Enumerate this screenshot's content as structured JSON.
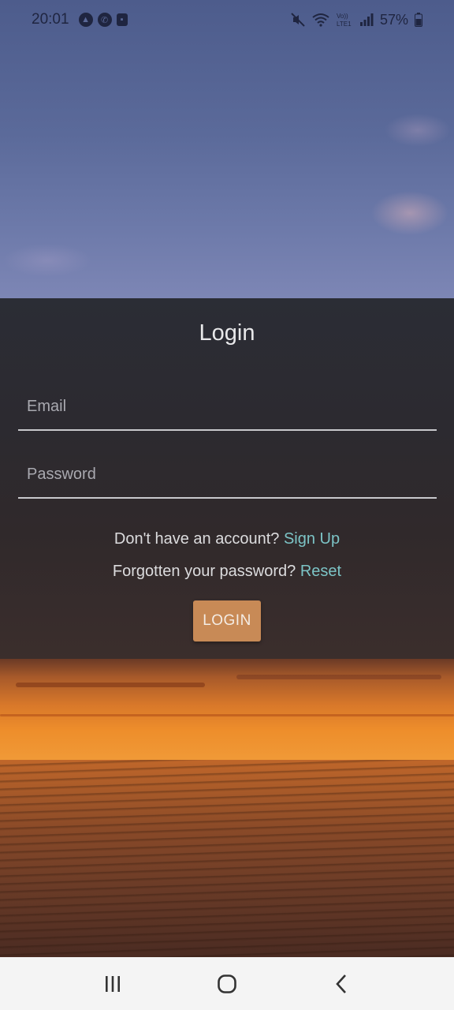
{
  "status_bar": {
    "time": "20:01",
    "left_icons": [
      "navigation-arrow-icon",
      "whatsapp-icon",
      "app-notification-icon"
    ],
    "right_icons": [
      "mute-icon",
      "wifi-icon",
      "volte-lte-icon",
      "signal-icon",
      "battery-icon"
    ],
    "battery_percent": "57%"
  },
  "login": {
    "title": "Login",
    "email_placeholder": "Email",
    "password_placeholder": "Password",
    "signup_prompt": "Don't have an account?",
    "signup_link": "Sign Up",
    "reset_prompt": "Forgotten your password?",
    "reset_link": "Reset",
    "login_button": "LOGIN"
  },
  "colors": {
    "link": "#7cc4c6",
    "button": "#c88a56"
  },
  "nav_bar": {
    "icons": [
      "recent-apps-icon",
      "home-icon",
      "back-icon"
    ]
  }
}
